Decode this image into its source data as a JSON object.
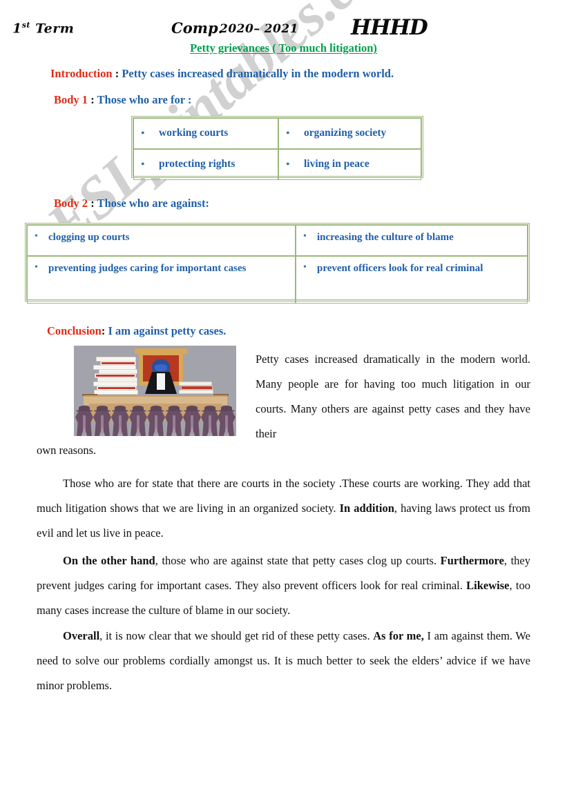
{
  "header": {
    "term": "1",
    "term_sup": "st",
    "term_word": "Term",
    "subject": "Comp.",
    "years": "2020– 2021",
    "initials": "HHHD"
  },
  "title": "Petty grievances ( Too much litigation)",
  "sections": {
    "introduction": {
      "label": "Introduction",
      "separator": " : ",
      "text": "Petty cases increased dramatically in the modern world."
    },
    "body1": {
      "label": "Body 1",
      "separator": " : ",
      "text": "Those who are for :"
    },
    "body2": {
      "label": "Body 2",
      "separator": " : ",
      "text": "Those who are against:"
    },
    "conclusion": {
      "label": "Conclusion",
      "separator": ": ",
      "text": "I am against petty cases."
    }
  },
  "table_for": {
    "bullet": "•",
    "cells": [
      "working courts",
      "organizing  society",
      "protecting rights",
      "living in peace"
    ]
  },
  "table_against": {
    "bullet": "•",
    "cells": [
      "clogging up courts",
      "increasing the culture of blame",
      "preventing judges caring for important cases",
      "prevent officers look for real criminal"
    ]
  },
  "illustration": {
    "alt": "courtroom-judge-with-paper-stacks-and-crowd"
  },
  "paragraphs": {
    "intro_main": "Petty cases increased dramatically in the modern world. Many people are for having too much litigation in our courts. Many others are against petty cases and they have their",
    "intro_tail": "own reasons.",
    "for_1": "Those who are for state that there are courts in the society .These courts are working. They add that much litigation shows that we are living in an organized society. ",
    "for_bold": "In addition",
    "for_2": ", having laws protect us from evil and let us live in peace.",
    "against_bold_1": "On the other hand",
    "against_1": ", those who are against state that petty cases clog up courts. ",
    "against_bold_2": "Furthermore",
    "against_2": ", they prevent judges caring for important cases. They also prevent officers look for real criminal. ",
    "against_bold_3": "Likewise",
    "against_3": ", too many cases increase the culture of blame in our society.",
    "overall_bold_1": "Overall",
    "overall_1": ", it is now clear that we should get rid of these petty cases. ",
    "overall_bold_2": "As for me,",
    "overall_2": " I am against them. We need to solve our problems cordially amongst us. It is much better to seek the elders’ advice if we have minor problems."
  },
  "watermark": "ESLprintables.com",
  "colors": {
    "title_green": "#00a14b",
    "label_red": "#e12a17",
    "text_blue": "#1f5fa8",
    "table_border_green": "#9cb87a",
    "body_text": "#111111",
    "watermark_gray": "#c9c9c9"
  }
}
